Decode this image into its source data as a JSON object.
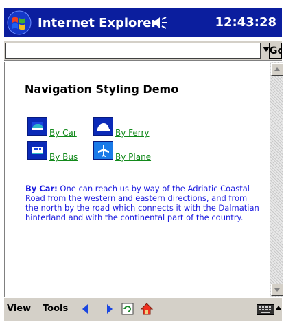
{
  "titlebar": {
    "app_title": "Internet Explorer",
    "clock": "12:43:28",
    "start_icon": "windows-flag-icon",
    "volume_icon": "speaker-icon"
  },
  "addressbar": {
    "url_value": "",
    "go_label": "Go"
  },
  "page": {
    "heading": "Navigation Styling Demo",
    "links": [
      {
        "label": "By Car",
        "icon": "car-icon"
      },
      {
        "label": "By Ferry",
        "icon": "ferry-icon"
      },
      {
        "label": "By Bus",
        "icon": "bus-icon"
      },
      {
        "label": "By Plane",
        "icon": "plane-icon"
      }
    ],
    "desc_bold": "By Car:",
    "desc_text": " One can reach us by way of the Adriatic Coastal Road from the western and eastern directions, and from the north by the road which connects it with the Dalmatian hinterland and with the continental part of the country."
  },
  "toolbar": {
    "view_label": "View",
    "tools_label": "Tools"
  },
  "colors": {
    "titlebar_bg": "#0b1e9e",
    "link_color": "#138a1c",
    "desc_color": "#1a1adf",
    "icon_bg": "#0b2ab8"
  }
}
